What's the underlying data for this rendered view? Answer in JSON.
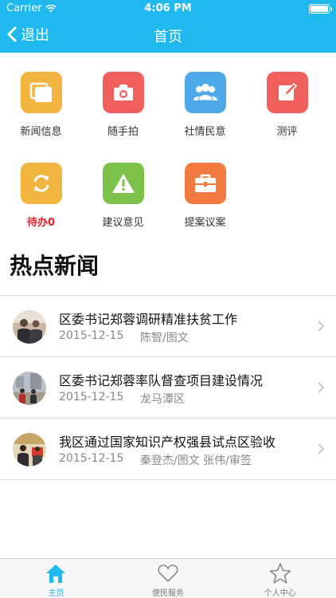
{
  "status_bar": {
    "carrier": "Carrier",
    "time": "4:06 PM"
  },
  "nav": {
    "back_label": "退出",
    "title": "首页"
  },
  "colors": {
    "header": "#1fb8ef",
    "tile_news": "#f2b53f",
    "tile_photo": "#f15f5d",
    "tile_opinion": "#4ea9e8",
    "tile_review": "#f15f5d",
    "tile_todo": "#f2b53f",
    "tile_suggest": "#7bc14a",
    "tile_proposal": "#f27a40",
    "alert_text": "#e0232b"
  },
  "features": [
    {
      "label": "新闻信息",
      "icon": "news-window-icon"
    },
    {
      "label": "随手拍",
      "icon": "camera-icon"
    },
    {
      "label": "社情民意",
      "icon": "people-icon"
    },
    {
      "label": "测评",
      "icon": "edit-icon"
    },
    {
      "label": "待办0",
      "icon": "refresh-icon"
    },
    {
      "label": "建议意见",
      "icon": "warning-icon"
    },
    {
      "label": "提案议案",
      "icon": "briefcase-icon"
    }
  ],
  "section": {
    "title": "热点新闻"
  },
  "news": [
    {
      "title": "区委书记郑蓉调研精准扶贫工作",
      "date": "2015-12-15",
      "author": "陈智/图文"
    },
    {
      "title": "区委书记郑蓉率队督查项目建设情况",
      "date": "2015-12-15",
      "author": "龙马潭区"
    },
    {
      "title": "我区通过国家知识产权强县试点区验收",
      "date": "2015-12-15",
      "author": "秦登杰/图文 张伟/审签"
    }
  ],
  "tabs": [
    {
      "label": "主页",
      "icon": "home-icon",
      "active": true
    },
    {
      "label": "便民服务",
      "icon": "heart-icon",
      "active": false
    },
    {
      "label": "个人中心",
      "icon": "star-icon",
      "active": false
    }
  ]
}
